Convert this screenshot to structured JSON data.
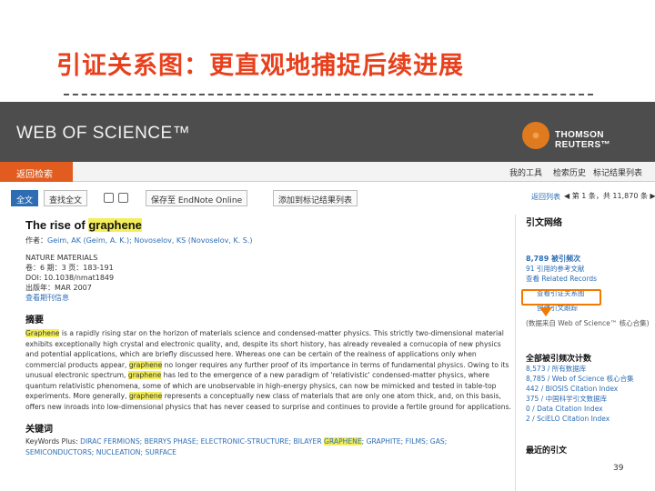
{
  "slide": {
    "title": "引证关系图：更直观地捕捉后续进展",
    "page_number": "39"
  },
  "header": {
    "logo": "WEB OF SCIENCE™",
    "partner_logo": "THOMSON REUTERS™"
  },
  "nav": {
    "back": "返回检索",
    "my_tools": "我的工具",
    "history": "检索历史",
    "marked_list": "标记结果列表"
  },
  "toolbar": {
    "full_text": "全文",
    "find_full_text": "查找全文",
    "save_endnote": "保存至 EndNote Online",
    "add_marked": "添加到标记结果列表",
    "return_list": "返回列表",
    "page_info": "◀ 第 1 条，共 11,870 条 ▶"
  },
  "article": {
    "title_prefix": "The rise of ",
    "title_highlight": "graphene",
    "authors_label": "作者：",
    "authors": "Geim, AK (Geim, A. K.); Novoselov, KS (Novoselov, K. S.)",
    "journal": "NATURE MATERIALS",
    "volume_issue": "卷：6  期：3  页：183-191",
    "doi": "DOI: 10.1038/nmat1849",
    "published": "出版年：MAR 2007",
    "view_journal": "查看期刊信息"
  },
  "abstract": {
    "heading": "摘要",
    "p1_hl": "Graphene",
    "p1": " is a rapidly rising star on the horizon of materials science and condensed-matter physics. This strictly two-dimensional material exhibits exceptionally high crystal and electronic quality, and, despite its short history, has already revealed a cornucopia of new physics and potential applications, which are briefly discussed here. Whereas one can be certain of the realness of applications only when commercial products appear, ",
    "p2_hl": "graphene",
    "p2": " no longer requires any further proof of its importance in terms of fundamental physics. Owing to its unusual electronic spectrum, ",
    "p3_hl": "graphene",
    "p3": " has led to the emergence of a new paradigm of 'relativistic' condensed-matter physics, where quantum relativistic phenomena, some of which are unobservable in high-energy physics, can now be mimicked and tested in table-top experiments. More generally, ",
    "p4_hl": "graphene",
    "p4": " represents a conceptually new class of materials that are only one atom thick, and, on this basis, offers new inroads into low-dimensional physics that has never ceased to surprise and continues to provide a fertile ground for applications."
  },
  "keywords": {
    "heading": "关键词",
    "plus_label": "KeyWords Plus: ",
    "k1": "DIRAC FERMIONS; BERRYS PHASE; ELECTRONIC-STRUCTURE; BILAYER ",
    "k_hl": "GRAPHENE",
    "k2": "; GRAPHITE; FILMS; GAS; SEMICONDUCTORS; NUCLEATION; SURFACE"
  },
  "citation_network": {
    "heading": "引文网络",
    "times_cited": "8,789 被引频次",
    "cited_refs": "91 引用的参考文献",
    "related": "查看 Related Records",
    "citation_map": "查看引证关系图",
    "create_alert": "创建引文跟踪",
    "note": "(数据来自 Web of Science™ 核心合集)",
    "all_db_heading": "全部被引频次计数",
    "counts": [
      "8,573 / 所有数据库",
      "8,785 / Web of Science 核心合集",
      "442 / BIOSIS Citation Index",
      "375 / 中国科学引文数据库",
      "0 / Data Citation Index",
      "2 / SciELO Citation Index"
    ],
    "recent_heading": "最近的引文"
  },
  "colors": {
    "accent": "#e25c1f",
    "header": "#4d4d4d",
    "highlight_box": "#f27a00",
    "title": "#e8401c"
  }
}
